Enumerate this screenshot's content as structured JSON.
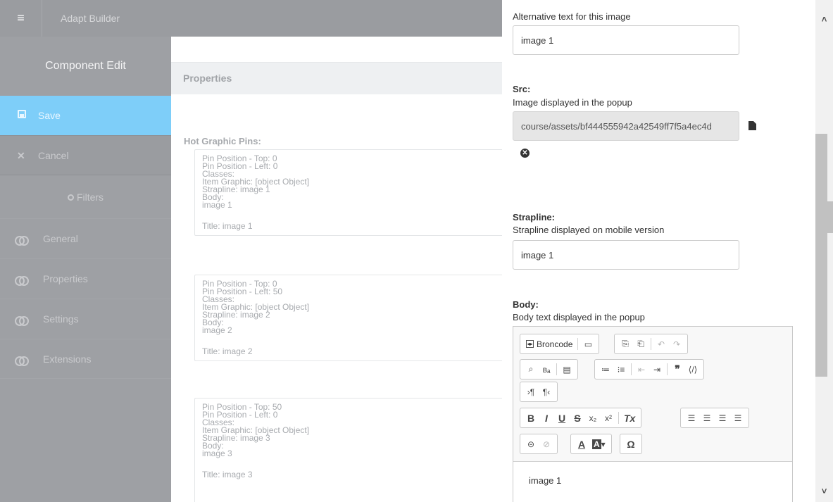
{
  "topbar": {
    "menu_icon": "hamburger-icon",
    "title": "Adapt Builder"
  },
  "sidebar": {
    "title": "Component Edit",
    "save_label": "Save",
    "cancel_label": "Cancel",
    "filters_label": "Filters",
    "items": [
      {
        "label": "General"
      },
      {
        "label": "Properties"
      },
      {
        "label": "Settings"
      },
      {
        "label": "Extensions"
      }
    ]
  },
  "middle": {
    "section_title": "Properties",
    "pins_title": "Hot Graphic Pins:",
    "pins": [
      {
        "top": "Pin Position - Top: 0",
        "left": "Pin Position - Left: 0",
        "classes": "Classes:",
        "graphic": "Item Graphic: [object Object]",
        "strapline": "Strapline: image 1",
        "body_label": "Body:",
        "body": "image 1",
        "title": "Title: image 1"
      },
      {
        "top": "Pin Position - Top: 0",
        "left": "Pin Position - Left: 50",
        "classes": "Classes:",
        "graphic": "Item Graphic: [object Object]",
        "strapline": "Strapline: image 2",
        "body_label": "Body:",
        "body": "image 2",
        "title": "Title: image 2"
      },
      {
        "top": "Pin Position - Top: 50",
        "left": "Pin Position - Left: 0",
        "classes": "Classes:",
        "graphic": "Item Graphic: [object Object]",
        "strapline": "Strapline: image 3",
        "body_label": "Body:",
        "body": "image 3",
        "title": "Title: image 3"
      }
    ]
  },
  "form": {
    "alt": {
      "help": "Alternative text for this image",
      "value": "image 1"
    },
    "src": {
      "label": "Src:",
      "help": "Image displayed in the popup",
      "value": "course/assets/bf444555942a42549ff7f5a4ec4d"
    },
    "strapline": {
      "label": "Strapline:",
      "help": "Strapline displayed on mobile version",
      "value": "image 1"
    },
    "body": {
      "label": "Body:",
      "help": "Body text displayed in the popup",
      "content": "image 1"
    }
  },
  "editor_toolbar": {
    "source_label": "Broncode",
    "ltr_label": "›¶",
    "rtl_label": "¶‹",
    "bold": "B",
    "italic": "I",
    "underline": "U",
    "strike": "S",
    "subscript": "x₂",
    "superscript": "x²",
    "remove_format": "Tx",
    "special_char": "Ω",
    "text_color": "A",
    "bg_color": "A"
  }
}
